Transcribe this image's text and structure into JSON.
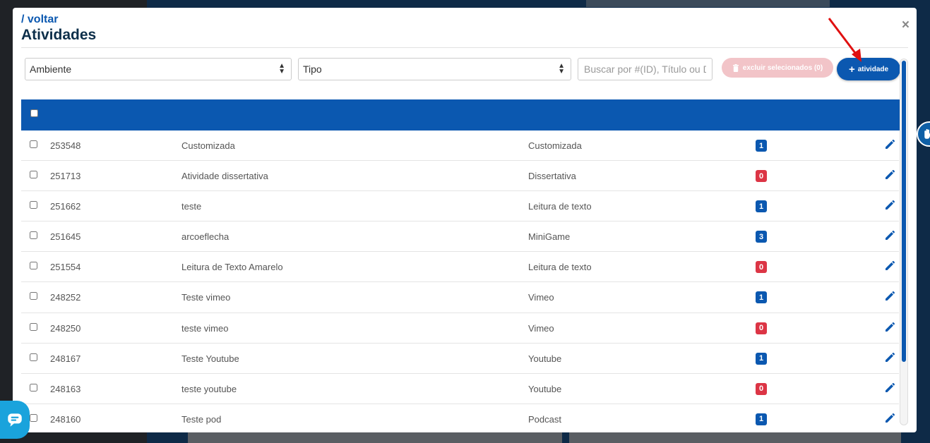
{
  "header": {
    "back_label": "/ voltar",
    "title": "Atividades",
    "close_label": "×"
  },
  "filters": {
    "ambiente_value": "Ambiente",
    "tipo_value": "Tipo",
    "search_placeholder": "Buscar por #(ID), Título ou Descrição"
  },
  "actions": {
    "delete_label": "excluir selecionados (0)",
    "add_label": "atividade"
  },
  "rows": [
    {
      "id": "253548",
      "title": "Customizada",
      "type": "Customizada",
      "count": "1",
      "status": "blue"
    },
    {
      "id": "251713",
      "title": "Atividade dissertativa",
      "type": "Dissertativa",
      "count": "0",
      "status": "red"
    },
    {
      "id": "251662",
      "title": "teste",
      "type": "Leitura de texto",
      "count": "1",
      "status": "blue"
    },
    {
      "id": "251645",
      "title": "arcoeflecha",
      "type": "MiniGame",
      "count": "3",
      "status": "blue"
    },
    {
      "id": "251554",
      "title": "Leitura de Texto Amarelo",
      "type": "Leitura de texto",
      "count": "0",
      "status": "red"
    },
    {
      "id": "248252",
      "title": "Teste vimeo",
      "type": "Vimeo",
      "count": "1",
      "status": "blue"
    },
    {
      "id": "248250",
      "title": "teste vimeo",
      "type": "Vimeo",
      "count": "0",
      "status": "red"
    },
    {
      "id": "248167",
      "title": "Teste Youtube",
      "type": "Youtube",
      "count": "1",
      "status": "blue"
    },
    {
      "id": "248163",
      "title": "teste youtube",
      "type": "Youtube",
      "count": "0",
      "status": "red"
    },
    {
      "id": "248160",
      "title": "Teste pod",
      "type": "Podcast",
      "count": "1",
      "status": "blue"
    }
  ],
  "colors": {
    "primary": "#0b58b0",
    "badge_blue": "#0b58b0",
    "badge_red": "#dc3545",
    "title": "#0d2f4a"
  },
  "icons": {
    "edit": "pencil-icon",
    "trash": "trash-icon",
    "plus": "plus-icon",
    "close": "close-icon",
    "chat": "chat-icon",
    "accessibility": "hand-accessibility-icon"
  }
}
